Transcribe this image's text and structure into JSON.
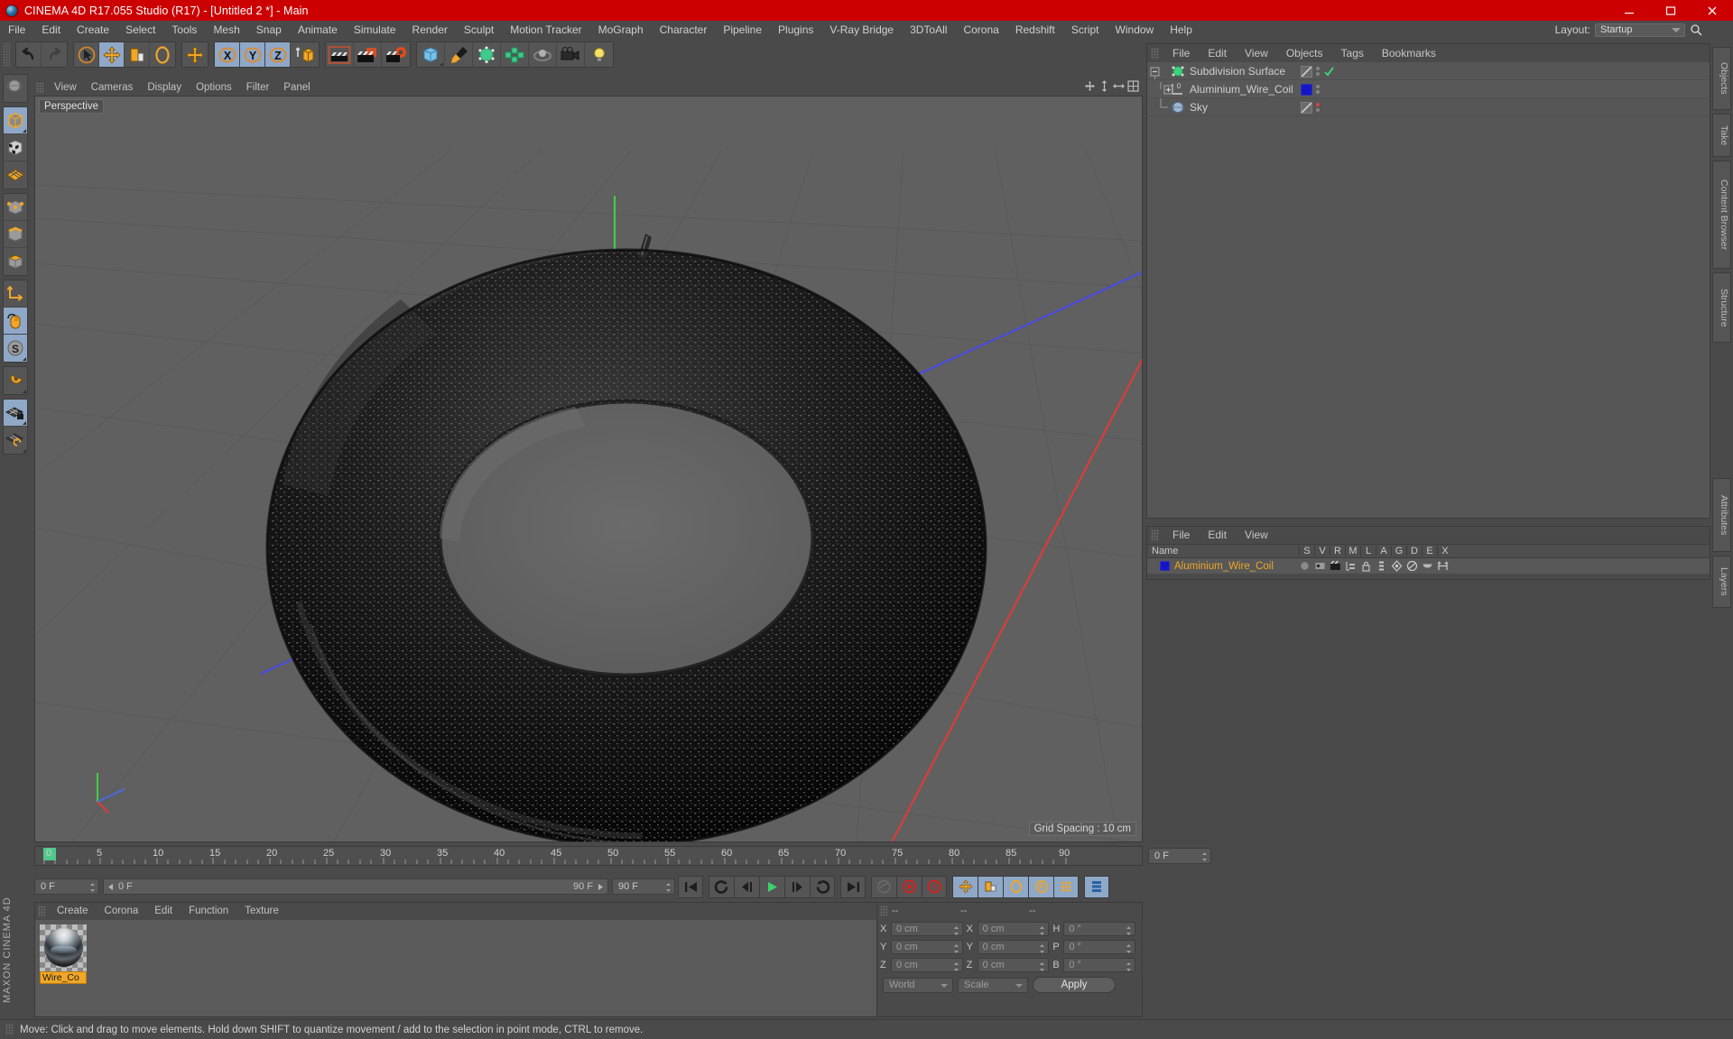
{
  "window": {
    "title": "CINEMA 4D R17.055 Studio (R17) - [Untitled 2 *] - Main",
    "app_icon": "c4d-logo-icon",
    "minimize": "minimize-icon",
    "maximize": "maximize-icon",
    "close": "close-icon",
    "titlebar_color": "#cc0000"
  },
  "menubar": {
    "items": [
      "File",
      "Edit",
      "Create",
      "Select",
      "Tools",
      "Mesh",
      "Snap",
      "Animate",
      "Simulate",
      "Render",
      "Sculpt",
      "Motion Tracker",
      "MoGraph",
      "Character",
      "Pipeline",
      "Plugins",
      "V-Ray Bridge",
      "3DToAll",
      "Corona",
      "Redshift",
      "Script",
      "Window",
      "Help"
    ],
    "layout_label": "Layout:",
    "layout_value": "Startup",
    "search_icon": "search-icon"
  },
  "toolbar": {
    "groups": [
      {
        "name": "history",
        "buttons": [
          {
            "icon": "undo-icon",
            "active": false
          },
          {
            "icon": "redo-icon",
            "active": false,
            "disabled": true
          }
        ]
      },
      {
        "name": "transform-tools",
        "buttons": [
          {
            "icon": "select-cursor-icon",
            "active": false
          },
          {
            "icon": "move-icon",
            "active": true
          },
          {
            "icon": "scale-icon",
            "active": false
          },
          {
            "icon": "rotate-icon",
            "active": false
          }
        ]
      },
      {
        "name": "move-extra",
        "buttons": [
          {
            "icon": "move-axis-icon",
            "active": false
          }
        ]
      },
      {
        "name": "axis-locks",
        "buttons": [
          {
            "icon": "x-axis-lock-icon",
            "active": true
          },
          {
            "icon": "y-axis-lock-icon",
            "active": true
          },
          {
            "icon": "z-axis-lock-icon",
            "active": true
          },
          {
            "icon": "world-object-axis-icon",
            "active": false
          }
        ]
      },
      {
        "name": "render-tools",
        "buttons": [
          {
            "icon": "render-view-icon",
            "active": false
          },
          {
            "icon": "render-to-picture-viewer-icon",
            "active": false
          },
          {
            "icon": "render-settings-icon",
            "active": false
          }
        ]
      },
      {
        "name": "object-create",
        "buttons": [
          {
            "icon": "cube-primitive-icon",
            "active": false
          },
          {
            "icon": "spline-pen-icon",
            "active": false
          },
          {
            "icon": "nurbs-generator-icon",
            "active": false
          },
          {
            "icon": "array-deformer-icon",
            "active": false
          },
          {
            "icon": "scene-object-icon",
            "active": false
          },
          {
            "icon": "camera-icon",
            "active": false
          },
          {
            "icon": "light-icon",
            "active": false
          }
        ]
      }
    ]
  },
  "left_toolbar": {
    "groups": [
      {
        "buttons": [
          {
            "icon": "viewport-globe-icon",
            "active": false
          }
        ]
      },
      {
        "buttons": [
          {
            "icon": "model-mode-icon",
            "active": true
          },
          {
            "icon": "texture-mode-icon",
            "active": false
          },
          {
            "icon": "workplane-mode-icon",
            "active": false
          }
        ]
      },
      {
        "buttons": [
          {
            "icon": "points-mode-icon",
            "active": false
          },
          {
            "icon": "edges-mode-icon",
            "active": false
          },
          {
            "icon": "polygons-mode-icon",
            "active": false
          }
        ]
      },
      {
        "buttons": [
          {
            "icon": "axis-modify-icon",
            "active": false
          },
          {
            "icon": "viewport-lock-mouse-icon",
            "active": true
          },
          {
            "icon": "soft-selection-icon",
            "active": true
          }
        ]
      },
      {
        "buttons": [
          {
            "icon": "magnet-icon",
            "active": false
          }
        ]
      },
      {
        "buttons": [
          {
            "icon": "snap-lock-icon",
            "active": true
          },
          {
            "icon": "workplane-rotate-icon",
            "active": false
          }
        ]
      }
    ],
    "brand": "MAXON CINEMA 4D"
  },
  "viewport": {
    "menu_items": [
      "View",
      "Cameras",
      "Display",
      "Options",
      "Filter",
      "Panel"
    ],
    "label": "Perspective",
    "grid_spacing": "Grid Spacing : 10 cm",
    "panel_icons": [
      "viewport-move-icon",
      "viewport-scale-icon",
      "viewport-rotate-icon",
      "viewport-maximize-icon"
    ],
    "axis_gizmo": "axis-gizmo-icon",
    "scene_object": "aluminium-wire-coil-torus"
  },
  "timeline": {
    "tick_labels": [
      "0",
      "5",
      "10",
      "15",
      "20",
      "25",
      "30",
      "35",
      "40",
      "45",
      "50",
      "55",
      "60",
      "65",
      "70",
      "75",
      "80",
      "85",
      "90"
    ],
    "current_frame_marker": 0,
    "end_field": "0 F"
  },
  "transport": {
    "current_frame": "0 F",
    "scrub_start": "0 F",
    "scrub_end": "90 F",
    "preview_end": "90 F",
    "buttons": [
      {
        "icon": "go-to-start-icon",
        "active": false
      },
      {
        "icon": "play-backwards-icon",
        "active": false
      },
      {
        "icon": "step-back-icon",
        "active": false
      },
      {
        "icon": "play-forward-icon",
        "active": false
      },
      {
        "icon": "step-forward-icon",
        "active": false
      },
      {
        "icon": "loop-icon",
        "active": false
      },
      {
        "icon": "go-to-end-icon",
        "active": false
      },
      {
        "icon": "autokey-link-icon",
        "active": false
      },
      {
        "icon": "record-keyframe-icon",
        "active": false
      },
      {
        "icon": "autokeying-icon",
        "active": false
      },
      {
        "icon": "key-position-icon",
        "active": true
      },
      {
        "icon": "key-scale-icon",
        "active": true
      },
      {
        "icon": "key-rotation-icon",
        "active": true
      },
      {
        "icon": "key-parameter-icon",
        "active": true
      },
      {
        "icon": "key-pla-icon",
        "active": true
      },
      {
        "icon": "timeline-settings-icon",
        "active": true
      }
    ]
  },
  "material_manager": {
    "menu_items": [
      "Create",
      "Corona",
      "Edit",
      "Function",
      "Texture"
    ],
    "materials": [
      {
        "name": "Wire_Co",
        "thumbnail": "chrome-sphere-preview",
        "selected": true
      }
    ]
  },
  "coordinate_manager": {
    "headers": [
      "--",
      "--",
      "--"
    ],
    "rows": [
      {
        "pos_label": "X",
        "pos_value": "0 cm",
        "size_label": "X",
        "size_value": "0 cm",
        "rot_label": "H",
        "rot_value": "0 °"
      },
      {
        "pos_label": "Y",
        "pos_value": "0 cm",
        "size_label": "Y",
        "size_value": "0 cm",
        "rot_label": "P",
        "rot_value": "0 °"
      },
      {
        "pos_label": "Z",
        "pos_value": "0 cm",
        "size_label": "Z",
        "size_value": "0 cm",
        "rot_label": "B",
        "rot_value": "0 °"
      }
    ],
    "coord_system": "World",
    "mode": "Scale",
    "apply_label": "Apply"
  },
  "object_manager": {
    "menu_items": [
      "File",
      "Edit",
      "View",
      "Objects",
      "Tags",
      "Bookmarks"
    ],
    "objects": [
      {
        "name": "Subdivision Surface",
        "icon": "subdivision-surface-icon",
        "depth": 0,
        "tag": "visibility-dots",
        "swatch": "diagonal",
        "check": true,
        "dot_color": "none"
      },
      {
        "name": "Aluminium_Wire_Coil",
        "icon": "layer-object-icon",
        "depth": 1,
        "tag": "material-tag",
        "swatch": "blue",
        "check": false,
        "dot_color": "none"
      },
      {
        "name": "Sky",
        "icon": "sky-object-icon",
        "depth": 1,
        "tag": "visibility-dots",
        "swatch": "diagonal",
        "check": false,
        "dot_color": "red"
      }
    ]
  },
  "layer_manager": {
    "menu_items": [
      "File",
      "Edit",
      "View"
    ],
    "columns": [
      "Name",
      "S",
      "V",
      "R",
      "M",
      "L",
      "A",
      "G",
      "D",
      "E",
      "X"
    ],
    "rows": [
      {
        "name": "Aluminium_Wire_Coil",
        "swatch_color": "#1515c8",
        "cells": [
          "solo-dot-icon",
          "view-icon",
          "render-icon",
          "manager-icon",
          "lock-icon",
          "animation-icon",
          "generator-icon",
          "deformer-icon",
          "expression-icon",
          "xref-icon"
        ]
      }
    ]
  },
  "right_dock": {
    "tabs": [
      "Objects",
      "Take",
      "Content Browser",
      "Structure",
      "Attributes",
      "Layers"
    ]
  },
  "statusbar": {
    "message": "Move: Click and drag to move elements. Hold down SHIFT to quantize movement / add to the selection in point mode, CTRL to remove."
  },
  "colors": {
    "accent_red": "#cc0000",
    "panel_bg": "#4a4a4a",
    "viewport_bg": "#606060",
    "selected_text": "#f0a628",
    "active_button": "#8fa8c8"
  }
}
